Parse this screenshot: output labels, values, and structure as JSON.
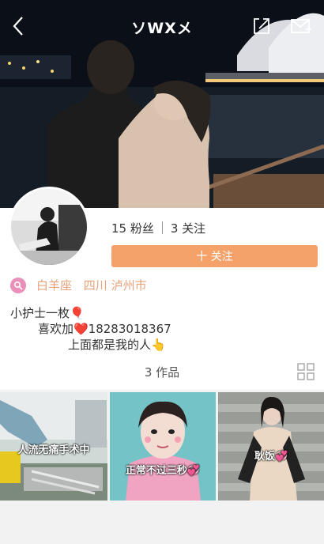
{
  "header": {
    "title": "ソWXメ"
  },
  "icons": {
    "back": "chevron-left-icon",
    "share": "share-icon",
    "message": "mail-icon",
    "location": "location-pin-icon",
    "grid": "grid-view-icon"
  },
  "profile": {
    "fans": "15 粉丝",
    "following": "3 关注",
    "follow_button": "十 关注",
    "zodiac": "白羊座",
    "location": "四川 泸州市",
    "bio_lines": [
      "小护士一枚🎈",
      "喜欢加❤️18283018367",
      "上面都是我的人👆"
    ]
  },
  "works": {
    "label": "3 作品",
    "items": [
      {
        "caption": "人流无痛手术中"
      },
      {
        "caption": "正常不过三秒💞"
      },
      {
        "caption": "耿饭💞"
      }
    ]
  },
  "colors": {
    "accent": "#f5a26a",
    "location_text": "#e8a27c",
    "location_icon": "#ea8fb9"
  }
}
